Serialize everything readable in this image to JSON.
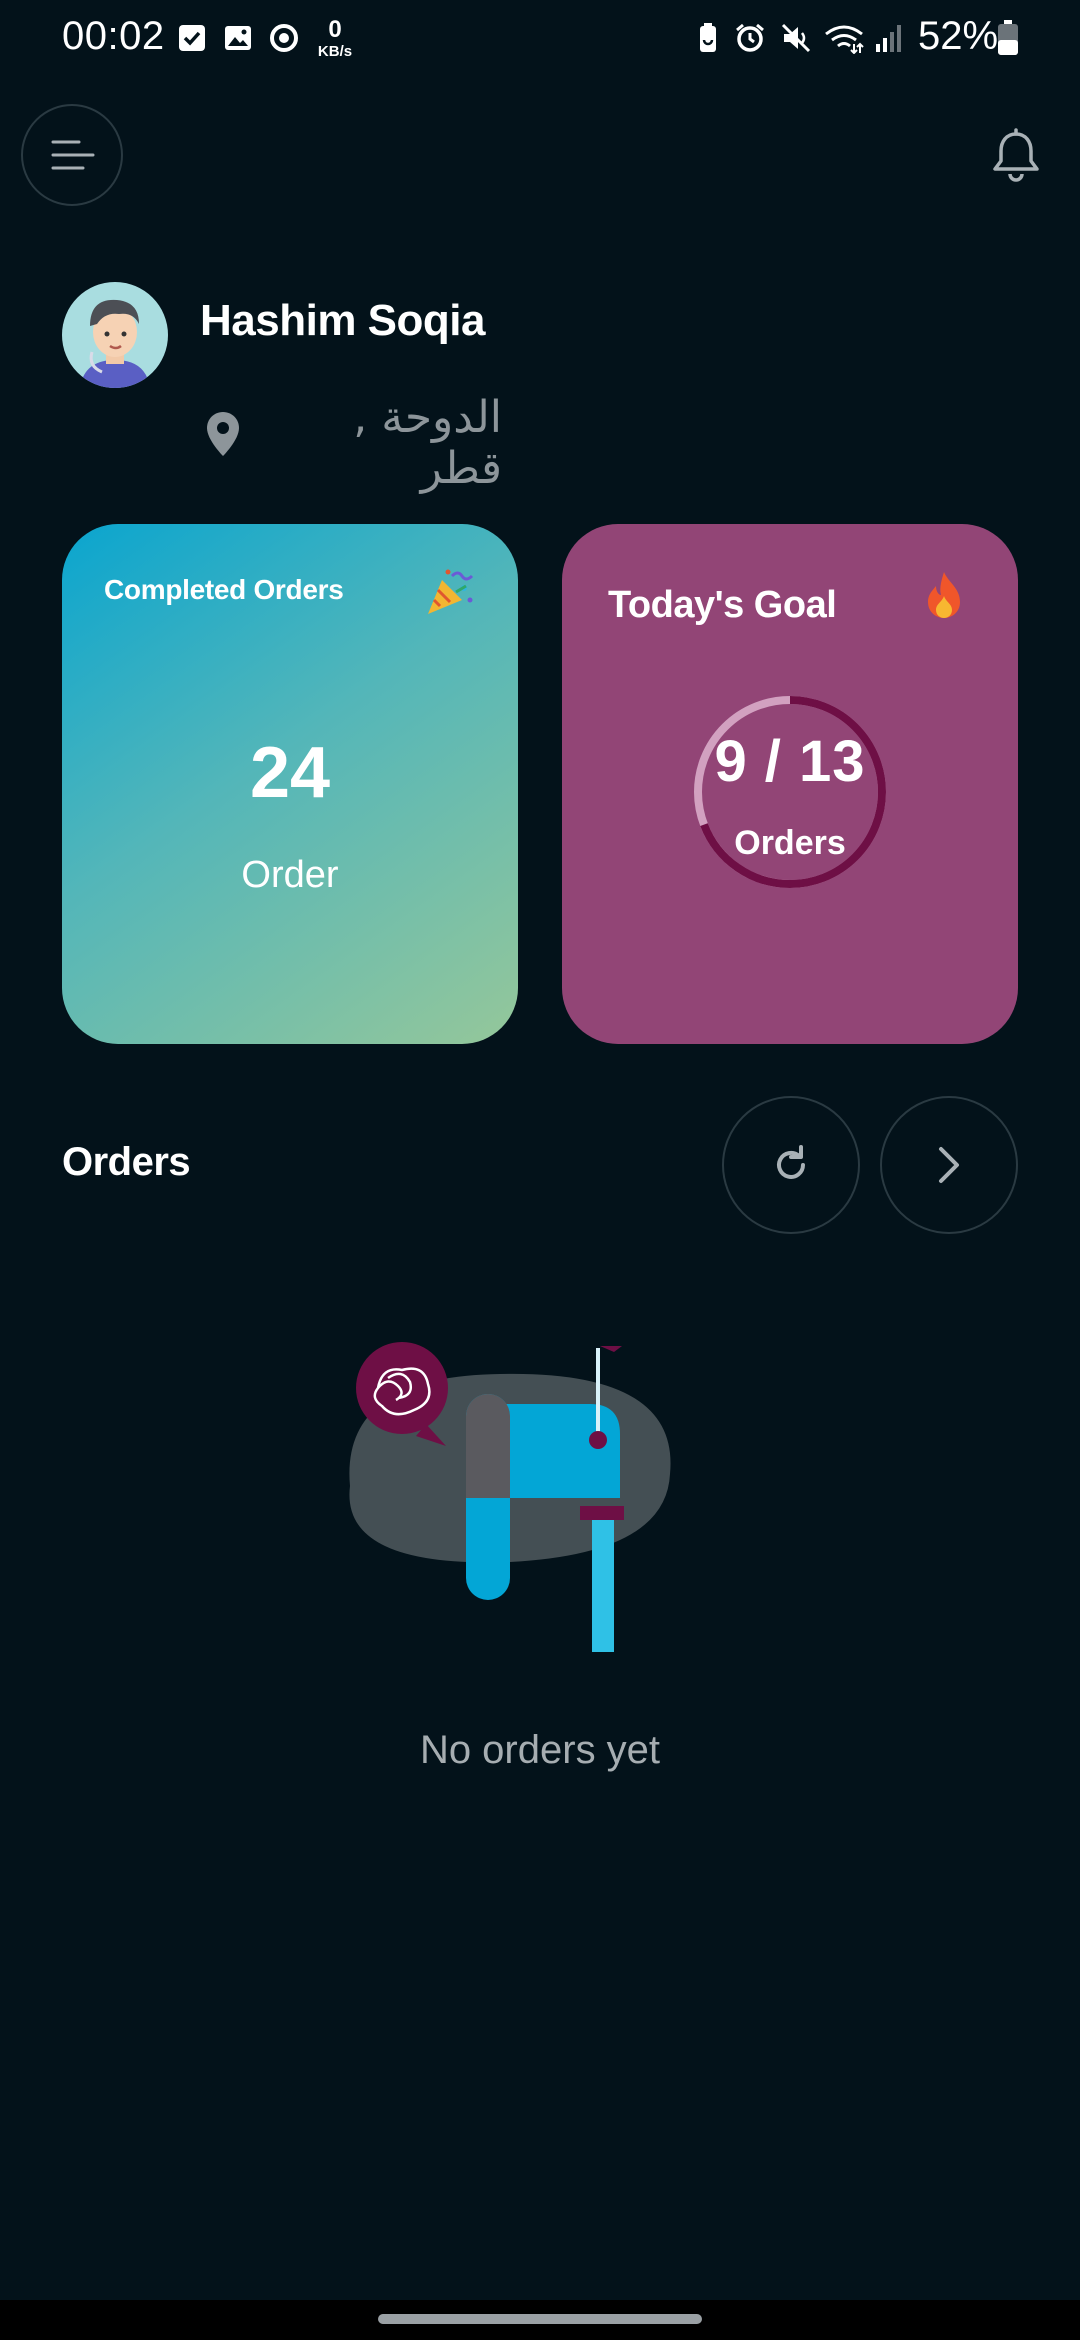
{
  "status_bar": {
    "time": "00:02",
    "network_speed_value": "0",
    "network_speed_unit": "KB/s",
    "battery_percent": "52%"
  },
  "header": {
    "menu_icon": "hamburger-menu-icon",
    "notification_icon": "bell-icon"
  },
  "profile": {
    "name": "Hashim Soqia",
    "location": "الدوحة , قطر",
    "location_icon": "map-pin-icon"
  },
  "cards": {
    "completed": {
      "title": "Completed Orders",
      "icon": "party-popper-icon",
      "value": "24",
      "unit": "Order",
      "colors": [
        "#0aa5cf",
        "#95c79a"
      ]
    },
    "goal": {
      "title": "Today's Goal",
      "icon": "fire-icon",
      "value": "9 / 13",
      "unit": "Orders",
      "progress_fraction": 0.692,
      "background": "#924576"
    }
  },
  "orders": {
    "title": "Orders",
    "refresh_icon": "refresh-icon",
    "next_icon": "chevron-right-icon",
    "empty_text": "No orders yet"
  }
}
